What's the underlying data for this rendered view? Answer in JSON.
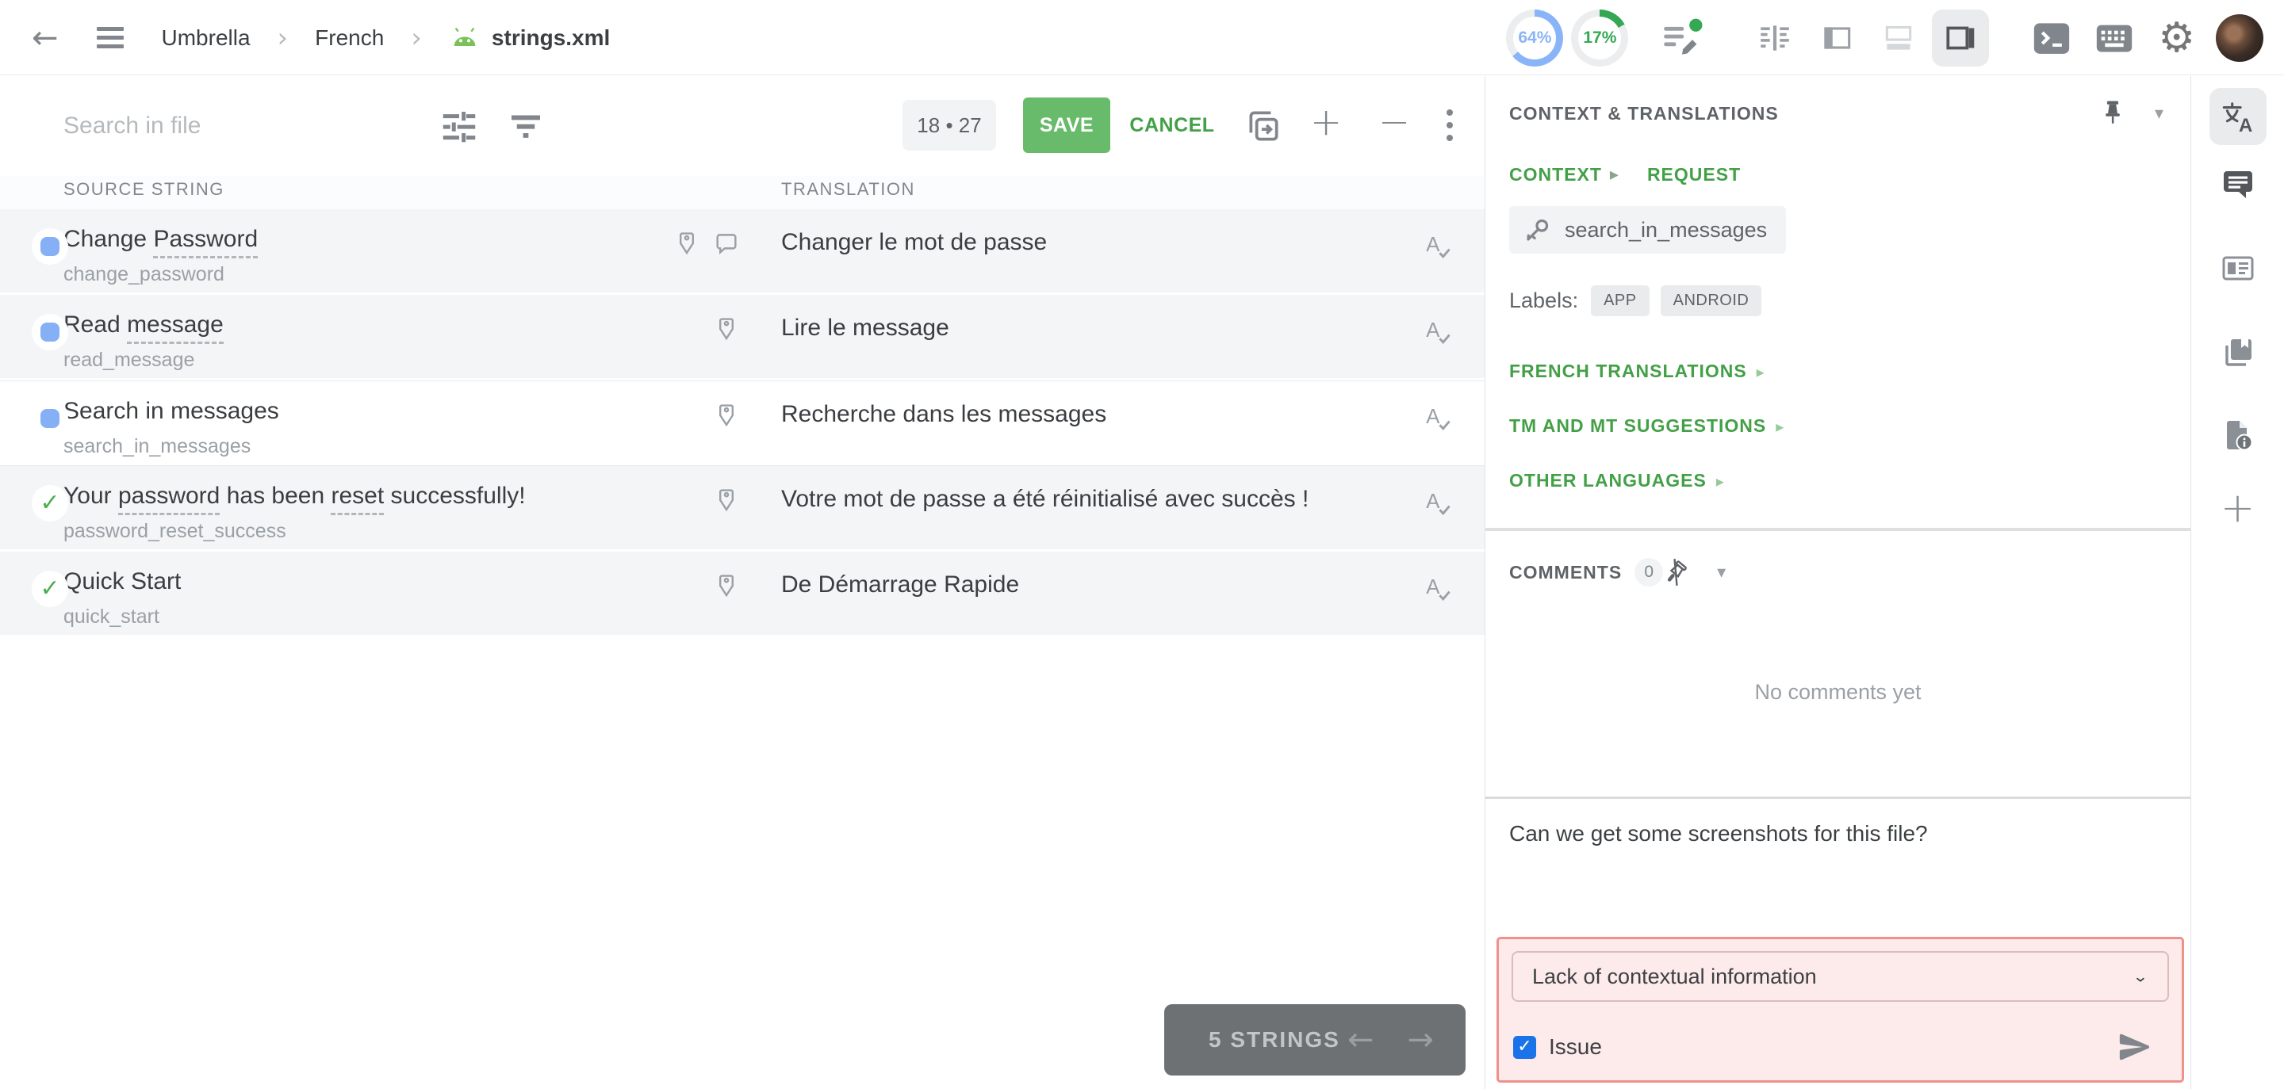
{
  "colors": {
    "accent_green": "#43a047",
    "progress_blue": "#8ab4f8",
    "progress_green": "#34a853",
    "checkbox_blue": "#1a73e8",
    "issue_border": "#f0908a",
    "issue_bg": "#fdeaea",
    "save_green": "#68bb6a"
  },
  "topbar": {
    "breadcrumb": {
      "project": "Umbrella",
      "language": "French",
      "file": "strings.xml"
    },
    "progress": [
      {
        "label": "64%",
        "pct": 64,
        "color": "#8ab4f8"
      },
      {
        "label": "17%",
        "pct": 17,
        "color": "#34a853"
      }
    ]
  },
  "toolbar": {
    "search_placeholder": "Search in file",
    "counter": "18 • 27",
    "save": "SAVE",
    "cancel": "CANCEL"
  },
  "table": {
    "source_header": "SOURCE STRING",
    "translation_header": "TRANSLATION",
    "rows": [
      {
        "status": "in-progress",
        "segments": [
          {
            "t": "Change "
          },
          {
            "t": "Password",
            "u": true
          }
        ],
        "key": "change_password",
        "icons": [
          "tag",
          "comment"
        ],
        "translation": "Changer le mot de passe",
        "active": false
      },
      {
        "status": "in-progress",
        "segments": [
          {
            "t": "Read "
          },
          {
            "t": "message",
            "u": true
          }
        ],
        "key": "read_message",
        "icons": [
          "tag"
        ],
        "translation": "Lire le message",
        "active": false
      },
      {
        "status": "in-progress",
        "segments": [
          {
            "t": "Search in messages"
          }
        ],
        "key": "search_in_messages",
        "icons": [
          "tag"
        ],
        "translation": "Recherche dans les messages",
        "active": true
      },
      {
        "status": "approved",
        "segments": [
          {
            "t": "Your "
          },
          {
            "t": "password",
            "u": true
          },
          {
            "t": " has been "
          },
          {
            "t": "reset",
            "u": true
          },
          {
            "t": " successfully!"
          }
        ],
        "key": "password_reset_success",
        "icons": [
          "tag"
        ],
        "translation": "Votre mot de passe a été réinitialisé avec succès !",
        "active": false
      },
      {
        "status": "approved",
        "segments": [
          {
            "t": "Quick Start"
          }
        ],
        "key": "quick_start",
        "icons": [
          "tag"
        ],
        "translation": "De Démarrage Rapide",
        "active": false
      }
    ]
  },
  "footer": {
    "strings_count": "5 STRINGS"
  },
  "sidebar": {
    "title": "CONTEXT & TRANSLATIONS",
    "tabs": {
      "context": "CONTEXT",
      "request": "REQUEST"
    },
    "string_key": "search_in_messages",
    "labels_title": "Labels:",
    "labels": [
      "APP",
      "ANDROID"
    ],
    "sections": [
      "FRENCH TRANSLATIONS",
      "TM AND MT SUGGESTIONS",
      "OTHER LANGUAGES"
    ],
    "comments": {
      "title": "COMMENTS",
      "count": "0",
      "empty": "No comments yet"
    },
    "comment_draft": "Can we get some screenshots for this file?",
    "issue": {
      "select_value": "Lack of contextual information",
      "checkbox_label": "Issue",
      "checked": true
    }
  }
}
